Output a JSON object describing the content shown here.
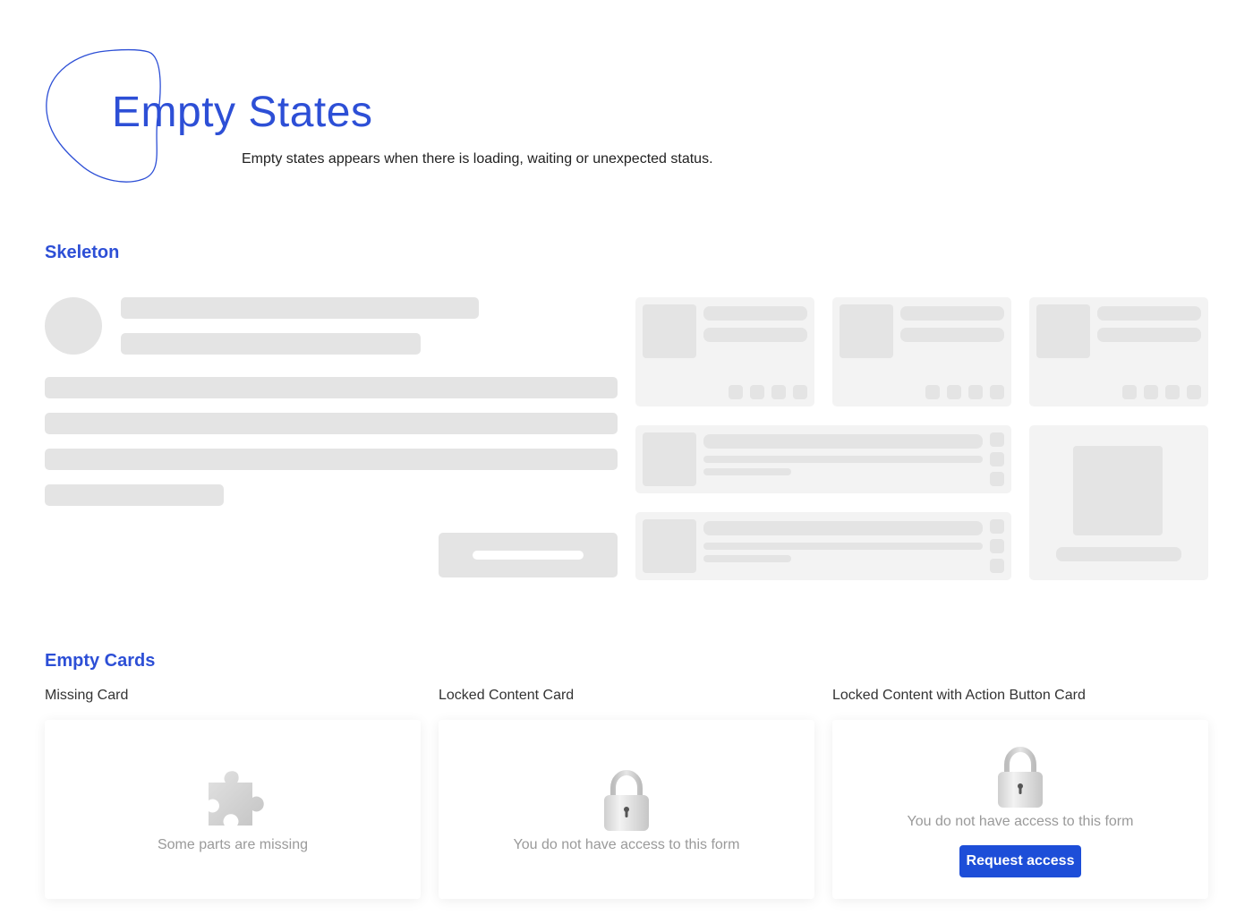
{
  "header": {
    "title": "Empty States",
    "subtitle": "Empty states appears when there is loading, waiting or unexpected status.",
    "accent_color": "#2d4fd6"
  },
  "skeleton": {
    "heading": "Skeleton",
    "placeholder_color": "#e4e4e4",
    "card_color": "#f3f3f3"
  },
  "empty_cards": {
    "heading": "Empty Cards",
    "cards": [
      {
        "label": "Missing Card",
        "message": "Some parts are missing",
        "icon": "puzzle-piece-icon"
      },
      {
        "label": "Locked Content Card",
        "message": "You do not have access to this form",
        "icon": "padlock-icon"
      },
      {
        "label": "Locked Content with Action Button Card",
        "message": "You do not have access to this form",
        "icon": "padlock-icon",
        "button_label": "Request access",
        "button_color": "#1d4ed8"
      }
    ]
  }
}
